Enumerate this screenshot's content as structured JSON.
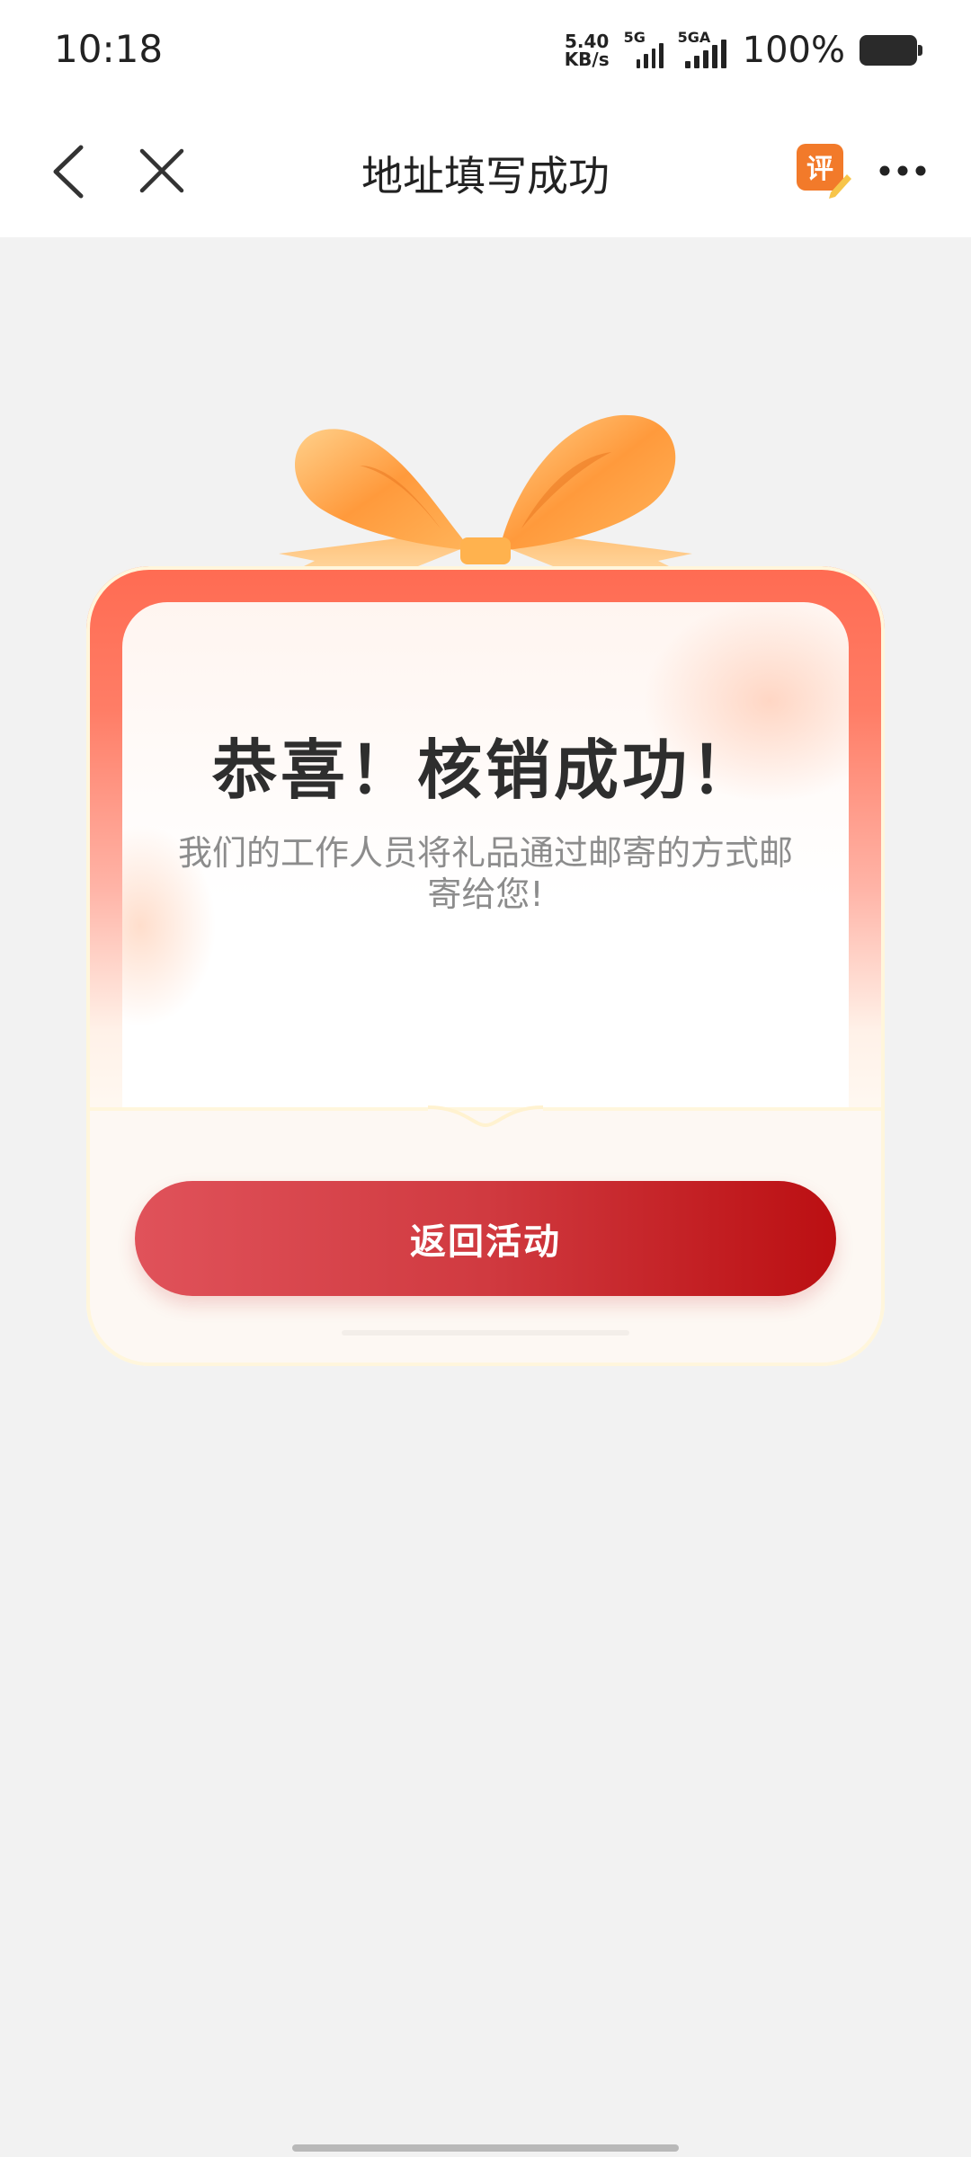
{
  "status_bar": {
    "time": "10:18",
    "net_speed_value": "5.40",
    "net_speed_unit": "KB/s",
    "sim1_label": "5G",
    "sim2_label": "5GA",
    "battery_percent": "100%"
  },
  "nav": {
    "title": "地址填写成功",
    "rate_label": "评"
  },
  "card": {
    "title": "恭喜！核销成功！",
    "message": "我们的工作人员将礼品通过邮寄的方式邮寄给您!",
    "button_label": "返回活动"
  },
  "colors": {
    "accent_red": "#bb0f12",
    "card_top": "#ff6b52",
    "bow_orange": "#ffa24a"
  }
}
